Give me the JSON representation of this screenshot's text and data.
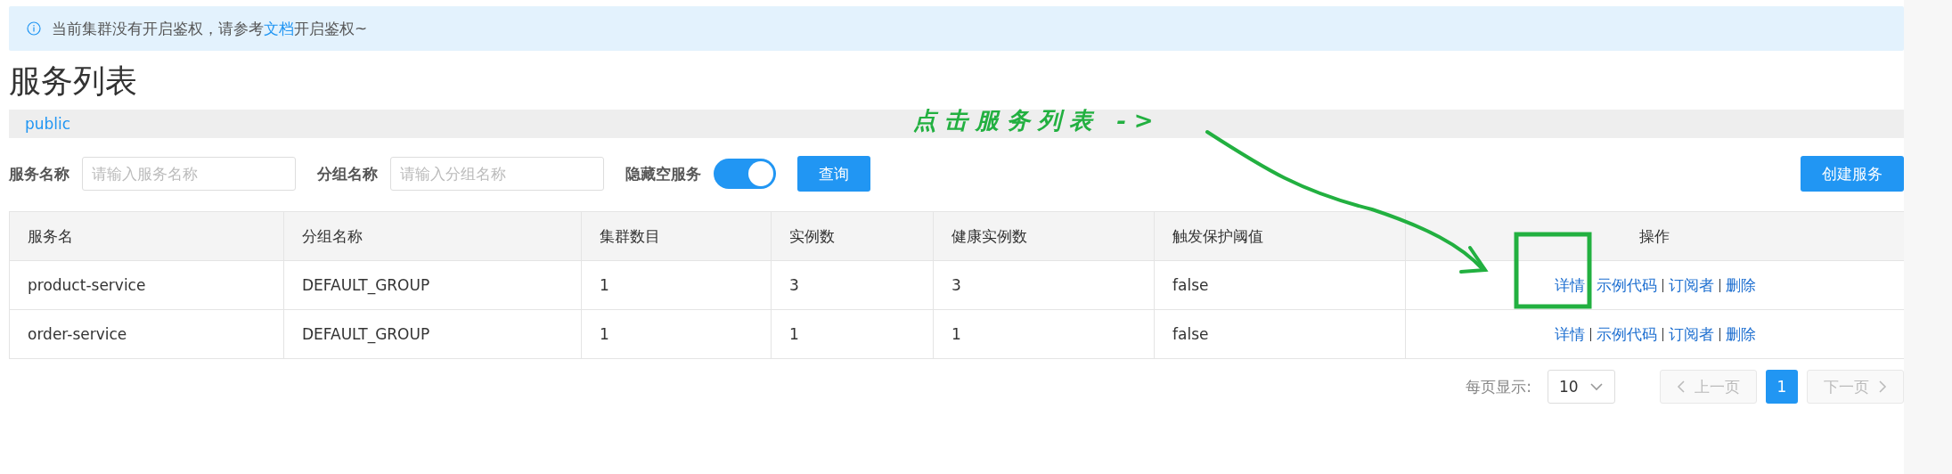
{
  "alert": {
    "text_before": "当前集群没有开启鉴权，请参考",
    "link": "文档",
    "text_after": "开启鉴权~"
  },
  "title": "服务列表",
  "namespaces": [
    {
      "label": "public",
      "selected": true
    }
  ],
  "filters": [
    {
      "label": "服务名称",
      "placeholder": "请输入服务名称"
    },
    {
      "label": "分组名称",
      "placeholder": "请输入分组名称"
    }
  ],
  "hide_empty": {
    "label": "隐藏空服务",
    "on": true
  },
  "query_button": "查询",
  "create_button": "创建服务",
  "table": {
    "columns": [
      "服务名",
      "分组名称",
      "集群数目",
      "实例数",
      "健康实例数",
      "触发保护阈值",
      "操作"
    ],
    "rows": [
      {
        "cells": [
          "product-service",
          "DEFAULT_GROUP",
          "1",
          "3",
          "3",
          "false"
        ],
        "actions": [
          "详情",
          "示例代码",
          "订阅者",
          "删除"
        ]
      },
      {
        "cells": [
          "order-service",
          "DEFAULT_GROUP",
          "1",
          "1",
          "1",
          "false"
        ],
        "actions": [
          "详情",
          "示例代码",
          "订阅者",
          "删除"
        ]
      }
    ]
  },
  "pagination": {
    "page_size_label": "每页显示:",
    "page_size": "10",
    "prev": {
      "label": "上一页",
      "disabled": true
    },
    "pages": [
      {
        "label": "1",
        "selected": true
      }
    ],
    "next": {
      "label": "下一页",
      "disabled": true
    }
  },
  "annotation": {
    "text": "点击服务列表 ->"
  }
}
